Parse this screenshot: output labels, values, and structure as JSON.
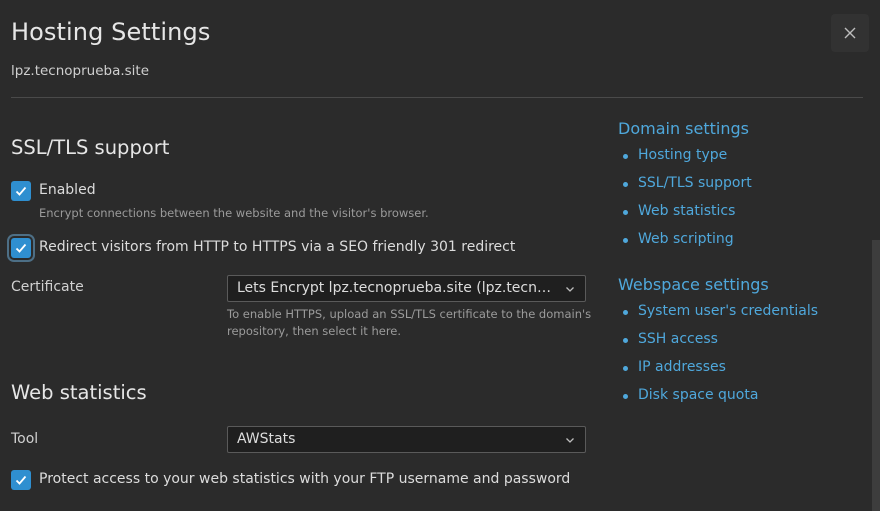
{
  "dialog": {
    "title": "Hosting Settings",
    "subtitle": "lpz.tecnoprueba.site"
  },
  "ssl": {
    "section_title": "SSL/TLS support",
    "enabled_label": "Enabled",
    "enabled_checked": true,
    "enabled_hint": "Encrypt connections between the website and the visitor's browser.",
    "redirect_label": "Redirect visitors from HTTP to HTTPS via a SEO friendly 301 redirect",
    "redirect_checked": true,
    "certificate_label": "Certificate",
    "certificate_value": "Lets Encrypt lpz.tecnoprueba.site (lpz.tecnoprueba.site)",
    "certificate_hint_line1": "To enable HTTPS, upload an SSL/TLS certificate to the domain's",
    "certificate_hint_line2": "repository, then select it here."
  },
  "webstats": {
    "section_title": "Web statistics",
    "tool_label": "Tool",
    "tool_value": "AWStats",
    "protect_label": "Protect access to your web statistics with your FTP username and password",
    "protect_checked": true
  },
  "nav": {
    "domain_title": "Domain settings",
    "domain_items": [
      "Hosting type",
      "SSL/TLS support",
      "Web statistics",
      "Web scripting"
    ],
    "webspace_title": "Webspace settings",
    "webspace_items": [
      "System user's credentials",
      "SSH access",
      "IP addresses",
      "Disk space quota"
    ]
  },
  "colors": {
    "background": "#2b2b2b",
    "accent": "#2f8fd0",
    "link": "#4fa8dc"
  },
  "icons": {
    "close": "close-icon",
    "check": "checkmark-icon",
    "chevron": "chevron-down-icon"
  }
}
